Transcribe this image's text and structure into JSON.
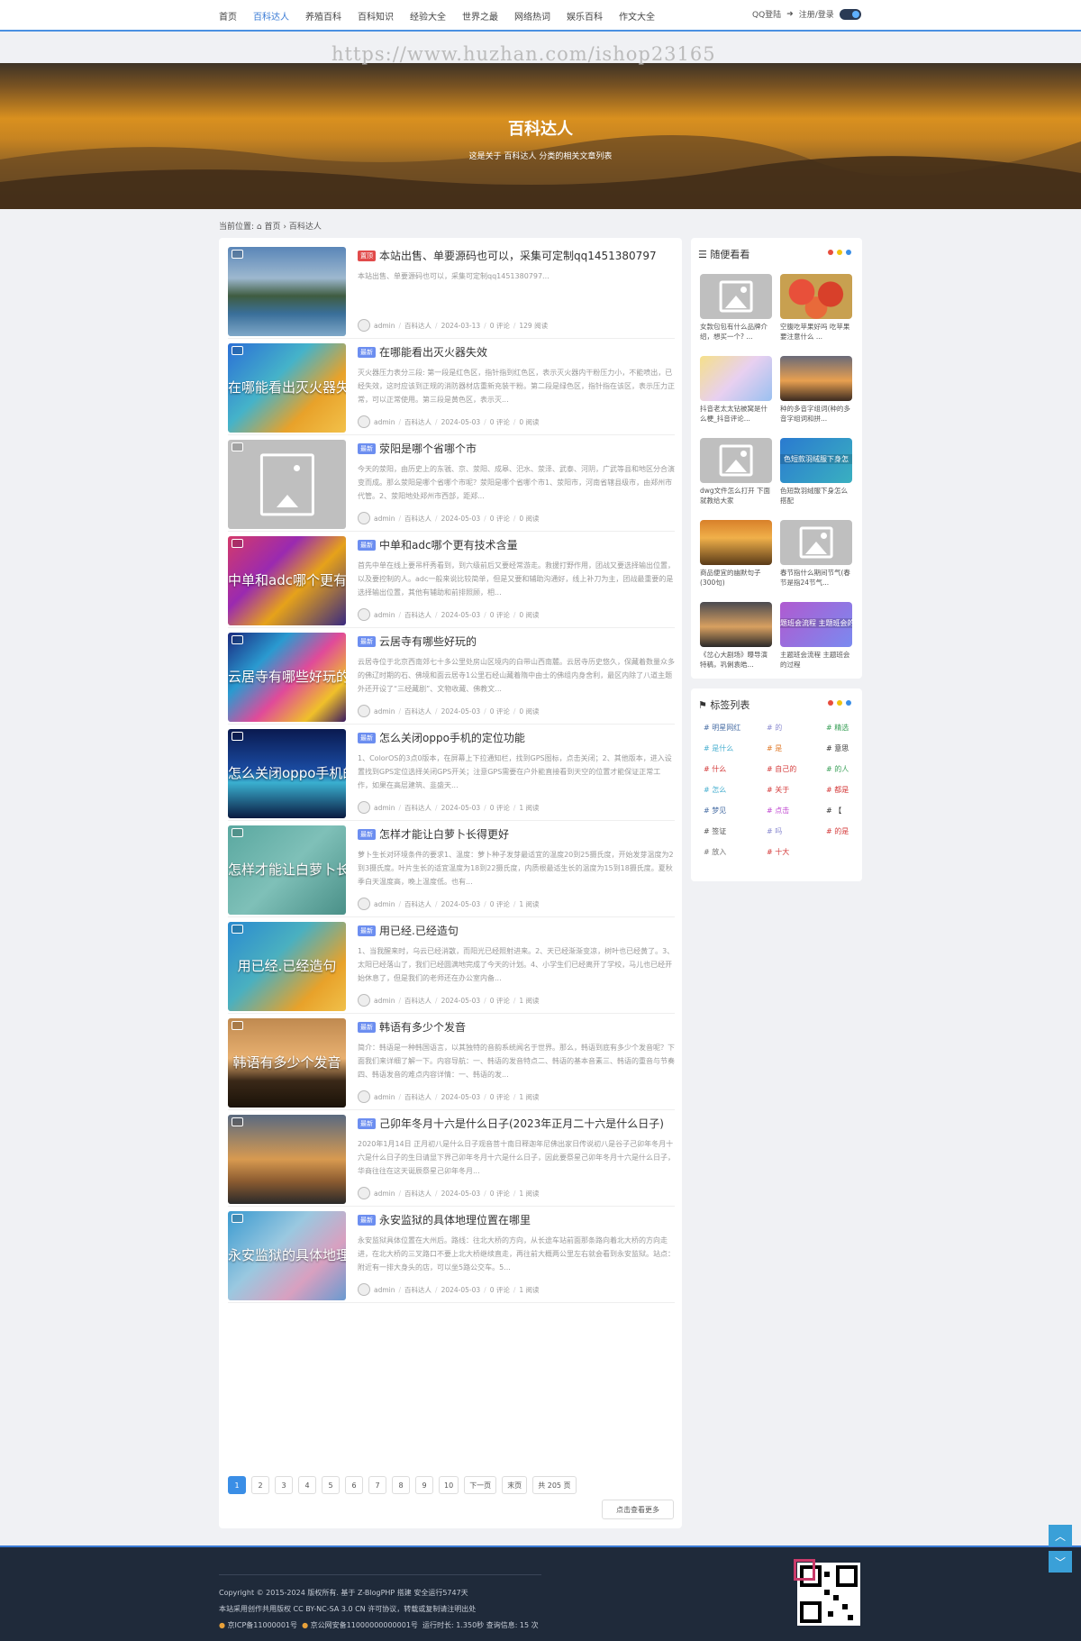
{
  "nav": {
    "items": [
      "首页",
      "百科达人",
      "养殖百科",
      "百科知识",
      "经验大全",
      "世界之最",
      "网络热词",
      "娱乐百科",
      "作文大全"
    ],
    "active_index": 1,
    "qq_login": "QQ登陆",
    "register_login": "注册/登录"
  },
  "watermark": "https://www.huzhan.com/ishop23165",
  "banner": {
    "title": "百科达人",
    "subtitle": "这是关于 百科达人 分类的相关文章列表"
  },
  "breadcrumb": {
    "prefix": "当前位置:",
    "home": "首页",
    "sep": "›",
    "current": "百科达人"
  },
  "posts": [
    {
      "badge": "置顶",
      "title": "本站出售、单要源码也可以，采集可定制qq1451380797",
      "desc": "本站出售、单要源码也可以，采集可定制qq1451380797...",
      "author": "admin",
      "category": "百科达人",
      "date": "2024-03-13",
      "comments": "0 评论",
      "views": "129 阅读",
      "overlay": ""
    },
    {
      "badge": "最新",
      "title": "在哪能看出灭火器失效",
      "desc": "灭火器压力表分三段: 第一段是红色区，指针指到红色区，表示灭火器内干粉压力小，不能喷出，已经失效，这时应该到正规的消防器材店重新充装干粉。第二段是绿色区，指针指在该区，表示压力正常，可以正常使用。第三段是黄色区，表示灭...",
      "author": "admin",
      "category": "百科达人",
      "date": "2024-05-03",
      "comments": "0 评论",
      "views": "0 阅读",
      "overlay": "在哪能看出灭火器失效"
    },
    {
      "badge": "最新",
      "title": "荥阳是哪个省哪个市",
      "desc": "今天的荥阳，由历史上的东虢、京、荥阳、成皋、汜水、荥泽、武泰、河阴，广武等县和地区分合演变而成。那么荥阳是哪个省哪个市呢？荥阳是哪个省哪个市1、荥阳市，河南省辖县级市，由郑州市代管。2、荥阳地处郑州市西部，距郑...",
      "author": "admin",
      "category": "百科达人",
      "date": "2024-05-03",
      "comments": "0 评论",
      "views": "0 阅读",
      "overlay": ""
    },
    {
      "badge": "最新",
      "title": "中单和adc哪个更有技术含量",
      "desc": "首先中单在线上要吊杆秀看到，到六级前后又要经常游走。救援打野作用，团战又要选择输出位置，以及要控制的人。adc一般来说比较简单，但是又要和辅助沟通好，线上补刀为主，团战最重要的是选择输出位置，其他有辅助和前排照顾，相...",
      "author": "admin",
      "category": "百科达人",
      "date": "2024-05-03",
      "comments": "0 评论",
      "views": "0 阅读",
      "overlay": "中单和adc哪个更有技术含量"
    },
    {
      "badge": "最新",
      "title": "云居寺有哪些好玩的",
      "desc": "云居寺位于北京西南郊七十多公里处房山区境内的白带山西南麓。云居寺历史悠久，保藏着数量众多的佛辽时期的石、佛境和面云居寺1公里石经山藏着隋中由士的佛组内身舍利，最区内除了八道主题外还开设了“三经藏剧”、文物收藏、佛教文...",
      "author": "admin",
      "category": "百科达人",
      "date": "2024-05-03",
      "comments": "0 评论",
      "views": "0 阅读",
      "overlay": "云居寺有哪些好玩的"
    },
    {
      "badge": "最新",
      "title": "怎么关闭oppo手机的定位功能",
      "desc": "1、ColorOS的3点0版本，在屏幕上下拉通知栏，找到GPS图标，点击关闭；2、其他版本，进入设置找到GPS定位选择关闭GPS开关；注意GPS需要在户外能直接看到天空的位置才能保证正常工作，如果在高层建筑、韭盛天...",
      "author": "admin",
      "category": "百科达人",
      "date": "2024-05-03",
      "comments": "0 评论",
      "views": "1 阅读",
      "overlay": "怎么关闭oppo手机的定位功能"
    },
    {
      "badge": "最新",
      "title": "怎样才能让白萝卜长得更好",
      "desc": "萝卜生长对环境条件的要求1、温度：萝卜种子发芽最适宜的温度20到25摄氏度，开始发芽温度为2到3摄氏度。叶片生长的适宜温度为18到22摄氏度，内质根最适生长的温度为15到18摄氏度。夏秋季白天温度高，晚上温度低。也有...",
      "author": "admin",
      "category": "百科达人",
      "date": "2024-05-03",
      "comments": "0 评论",
      "views": "1 阅读",
      "overlay": "怎样才能让白萝卜长得更好"
    },
    {
      "badge": "最新",
      "title": "用已经.已经造句",
      "desc": "1、当我醒来时，乌云已经消散，而阳光已经照射进来。2、天已经渐渐变凉，树叶也已经黄了。3、太阳已经落山了，我们已经圆满地完成了今天的计划。4、小学生们已经离开了学校，马儿也已经开始休息了，但是我们的老师还在办公室内备...",
      "author": "admin",
      "category": "百科达人",
      "date": "2024-05-03",
      "comments": "0 评论",
      "views": "1 阅读",
      "overlay": "用已经.已经造句"
    },
    {
      "badge": "最新",
      "title": "韩语有多少个发音",
      "desc": "简介：韩语是一种韩国语言，以其独特的音韵系统闻名于世界。那么，韩语到底有多少个发音呢？下面我们来详细了解一下。内容导航：一、韩语的发音特点二、韩语的基本音素三、韩语的重音与节奏四、韩语发音的难点内容详情：一、韩语的发...",
      "author": "admin",
      "category": "百科达人",
      "date": "2024-05-03",
      "comments": "0 评论",
      "views": "1 阅读",
      "overlay": "韩语有多少个发音"
    },
    {
      "badge": "最新",
      "title": "己卯年冬月十六是什么日子(2023年正月二十六是什么日子)",
      "desc": "2020年1月14日 正月初八是什么日子观音菩十南日释迦年尼佛出家日传说初八是谷子己卯年冬月十六是什么日子的生日请显下界己卯年冬月十六是什么日子，因此要祭星己卯年冬月十六是什么日子，华商往往在这天诞辰祭星己卯年冬月...",
      "author": "admin",
      "category": "百科达人",
      "date": "2024-05-03",
      "comments": "0 评论",
      "views": "1 阅读",
      "overlay": ""
    },
    {
      "badge": "最新",
      "title": "永安监狱的具体地理位置在哪里",
      "desc": "永安监狱具体位置在大州后。路线：往北大桥的方向，从长途车站前面那条路向着北大桥的方向走进，在北大桥的三叉路口不要上北大桥继续直走，再往前大概两公里左右就会看到永安监狱。站点：附近有一排大身头的店，可以坐5路公交车。5...",
      "author": "admin",
      "category": "百科达人",
      "date": "2024-05-03",
      "comments": "0 评论",
      "views": "1 阅读",
      "overlay": "永安监狱的具体地理位置在哪里"
    }
  ],
  "pager": {
    "pages": [
      "1",
      "2",
      "3",
      "4",
      "5",
      "6",
      "7",
      "8",
      "9",
      "10"
    ],
    "current": "1",
    "next": "下一页",
    "last": "末页",
    "total": "共 205 页",
    "more": "点击查看更多"
  },
  "random": {
    "title": "随便看看",
    "items": [
      {
        "text": "女款包包有什么品牌介绍，想买一个? ..."
      },
      {
        "text": "空腹吃苹果好吗 吃苹果要注意什么 ..."
      },
      {
        "text": "抖音老太太钻被窝是什么梗_抖音评论..."
      },
      {
        "text": "种的多音字组词(种的多音字组词和拼..."
      },
      {
        "text": "dwg文件怎么打开 下面就教给大家"
      },
      {
        "text": "色短款羽绒服下身怎么搭配",
        "img_text": "色短款羽绒服下身怎"
      },
      {
        "text": "商品便宜的幽默句子(300句)"
      },
      {
        "text": "春节指什么期间节气(春节是指24节气..."
      },
      {
        "text": "《岔心大剧场》曝导演特稿，巩俐袁皓..."
      },
      {
        "text": "主题班会流程 主题班会的过程",
        "img_text": "题班会流程 主题班会的过程"
      }
    ]
  },
  "tags": {
    "title": "标签列表",
    "items": [
      {
        "text": "# 明星网红",
        "color": "#4a6fa5"
      },
      {
        "text": "# 的",
        "color": "#8a8ad0"
      },
      {
        "text": "# 精选",
        "color": "#3aa058"
      },
      {
        "text": "# 是什么",
        "color": "#4ab0d0"
      },
      {
        "text": "# 是",
        "color": "#e07a2a"
      },
      {
        "text": "# 意思",
        "color": "#333333"
      },
      {
        "text": "# 什么",
        "color": "#d43a3a"
      },
      {
        "text": "# 自己的",
        "color": "#d43a3a"
      },
      {
        "text": "# 的人",
        "color": "#3aa058"
      },
      {
        "text": "# 怎么",
        "color": "#4ab0d0"
      },
      {
        "text": "# 关于",
        "color": "#d43a3a"
      },
      {
        "text": "# 都是",
        "color": "#d43a3a"
      },
      {
        "text": "# 梦见",
        "color": "#4a6fa5"
      },
      {
        "text": "# 点击",
        "color": "#c04ad0"
      },
      {
        "text": "# 【",
        "color": "#333333"
      },
      {
        "text": "# 签证",
        "color": "#555555"
      },
      {
        "text": "# 吗",
        "color": "#8a8ad0"
      },
      {
        "text": "# 的是",
        "color": "#d43a3a"
      },
      {
        "text": "# 放入",
        "color": "#777777"
      },
      {
        "text": "# 十大",
        "color": "#d43a3a"
      }
    ]
  },
  "footer": {
    "copyright": "Copyright © 2015-2024  版权所有. 基于 Z-BlogPHP 搭建 安全运行5747天",
    "license": "本站采用创作共用版权  CC BY-NC-SA 3.0 CN  许可协议，转载或复制请注明出处",
    "icp": "京ICP备11000001号",
    "police": "京公网安备11000000000001号",
    "runtime": "运行时长: 1.350秒  查询信息: 15 次"
  },
  "colors": {
    "accent": "#3a8ee6",
    "top_badge": "#e14b4b",
    "new_badge": "#6c8ef0",
    "footer_bg": "#1f2a3a"
  }
}
